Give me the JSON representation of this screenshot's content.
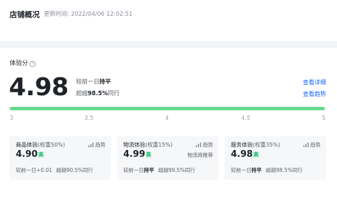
{
  "header": {
    "title": "店铺概况",
    "update_time": "更新时间: 2022/04/06 12:02:51"
  },
  "score": {
    "label": "体验分",
    "help_icon": "?",
    "value": "4.98",
    "compare_prefix": "较前一日",
    "compare_value": "持平",
    "exceed_prefix": "超越",
    "exceed_value": "98.5%",
    "exceed_suffix": "同行",
    "link_detail": "查看详细",
    "link_trend": "查看趋势",
    "progress_fraction": 0.996,
    "scale_ticks": [
      "3",
      "3.5",
      "4",
      "4.5",
      "5"
    ]
  },
  "cards": [
    {
      "title": "商品体验",
      "weight": "(权重50%)",
      "trend_label": "趋势",
      "score": "4.90",
      "badge": "高",
      "extra": "",
      "foot_prefix": "较前一日",
      "foot_change": "+0.01",
      "foot_exceed_prefix": "超越",
      "foot_exceed_value": "90.5%",
      "foot_exceed_suffix": "同行"
    },
    {
      "title": "物流体验",
      "weight": "(权重15%)",
      "trend_label": "趋势",
      "score": "4.99",
      "badge": "高",
      "extra": "物流商推荐",
      "foot_prefix": "较前一日",
      "foot_change": "持平",
      "foot_exceed_prefix": "超越",
      "foot_exceed_value": "99.5%",
      "foot_exceed_suffix": "同行"
    },
    {
      "title": "服务体验",
      "weight": "(权重35%)",
      "trend_label": "趋势",
      "score": "4.98",
      "badge": "高",
      "extra": "",
      "foot_prefix": "较前一日",
      "foot_change": "持平",
      "foot_exceed_prefix": "超越",
      "foot_exceed_value": "98.5%",
      "foot_exceed_suffix": "同行"
    }
  ],
  "colors": {
    "accent_link": "#1966ff",
    "progress": "#66d98c",
    "badge_text": "#15b76c",
    "badge_bg": "#e3f7ec"
  }
}
